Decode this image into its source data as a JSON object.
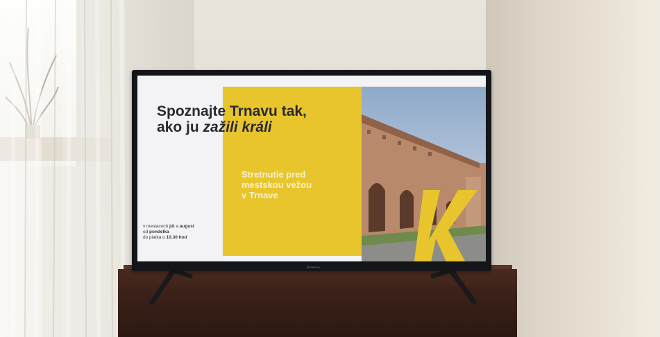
{
  "tv_screen": {
    "headline_line1": "Spoznajte Trnavu tak,",
    "headline_line2_prefix": "ako ju ",
    "headline_line2_italic": "zažili králi",
    "panel_text_line1": "Stretnutie pred",
    "panel_text_line2": "mestskou vežou",
    "panel_text_line3": "v Trnave",
    "schedule_line1_prefix": "v mesiacoch ",
    "schedule_line1_bold1": "júl",
    "schedule_line1_mid": " a ",
    "schedule_line1_bold2": "august",
    "schedule_line2_prefix": "od ",
    "schedule_line2_bold": "pondelka",
    "schedule_line3_prefix": "do piatka o ",
    "schedule_line3_bold": "10.30 hod",
    "logo_letter": "K",
    "brand": "Hisense"
  },
  "colors": {
    "accent_yellow": "#e8c52d",
    "screen_background": "#f3f2f5",
    "headline_text": "#2a2830"
  }
}
